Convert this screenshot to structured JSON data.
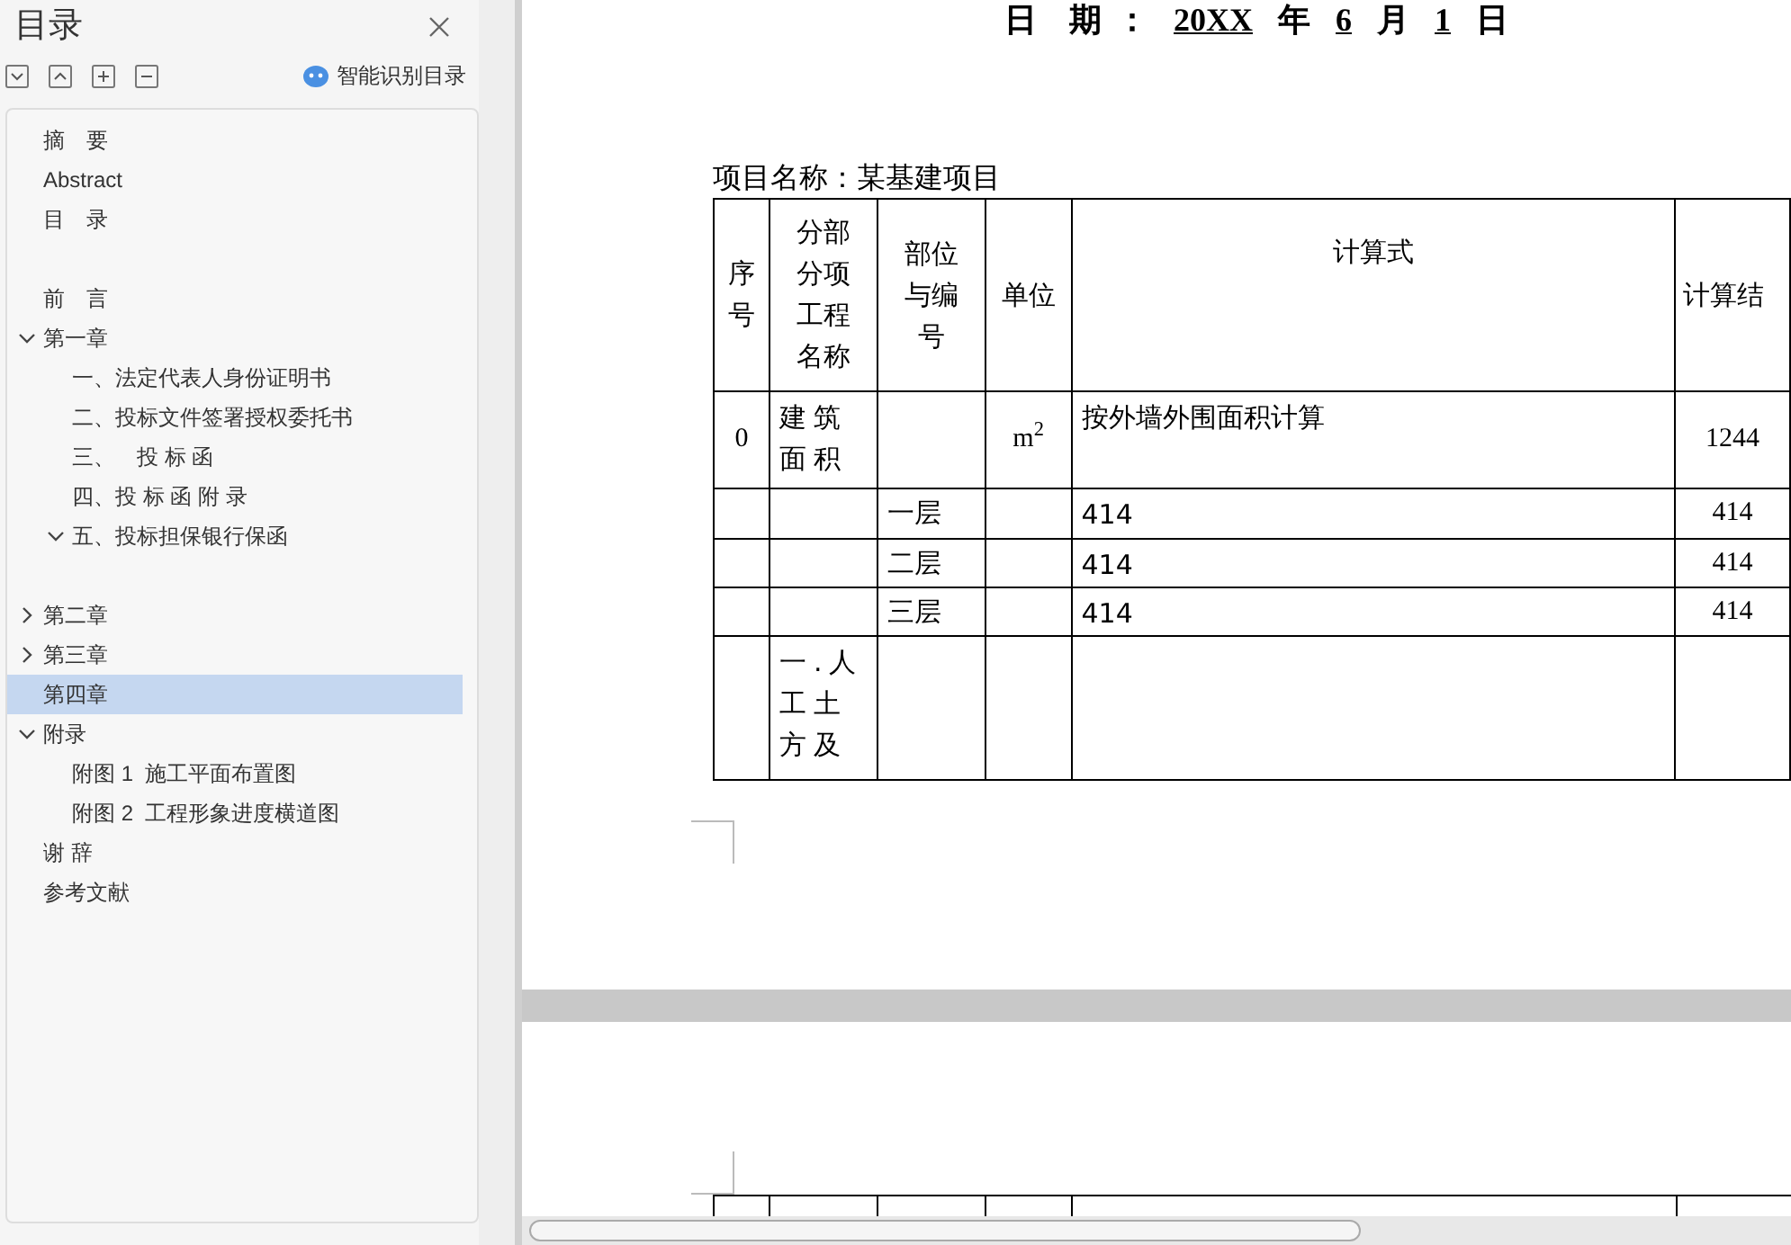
{
  "toc": {
    "title": "目录",
    "smart_button": "智能识别目录",
    "items": [
      {
        "label": "摘　要",
        "selected": false
      },
      {
        "label": "Abstract",
        "selected": false
      },
      {
        "label": "目　录",
        "selected": false
      },
      {
        "label": "前　言",
        "selected": false,
        "spaced": true
      },
      {
        "label": "第一章",
        "selected": false,
        "expanded": true,
        "children": [
          {
            "label": "一、法定代表人身份证明书",
            "selected": false
          },
          {
            "label": "二、投标文件签署授权委托书",
            "selected": false
          },
          {
            "label": "三、　投 标 函",
            "selected": false
          },
          {
            "label": "四、投 标 函 附 录",
            "selected": false
          },
          {
            "label": "五、投标担保银行保函",
            "selected": false,
            "expanded": true
          }
        ]
      },
      {
        "label": "第二章",
        "selected": false,
        "expanded": false,
        "spaced": true
      },
      {
        "label": "第三章",
        "selected": false,
        "expanded": false
      },
      {
        "label": "第四章",
        "selected": true
      },
      {
        "label": "附录",
        "selected": false,
        "expanded": true,
        "children": [
          {
            "label": "附图 1  施工平面布置图",
            "selected": false
          },
          {
            "label": "附图 2  工程形象进度横道图",
            "selected": false
          }
        ]
      },
      {
        "label": "谢 辞",
        "selected": false
      },
      {
        "label": "参考文献",
        "selected": false
      }
    ]
  },
  "document": {
    "date_line": [
      {
        "text": "日　期",
        "underlined": false
      },
      {
        "text": "：",
        "underlined": false
      },
      {
        "text": "20XX",
        "underlined": true
      },
      {
        "text": "年",
        "underlined": false
      },
      {
        "text": "6",
        "underlined": true
      },
      {
        "text": "月",
        "underlined": false
      },
      {
        "text": "1",
        "underlined": true
      },
      {
        "text": "日",
        "underlined": false
      }
    ],
    "project_label": "项目名称：某基建项目",
    "table": {
      "columns": [
        "序号",
        "分部分项工程名称",
        "部位与编号",
        "单位",
        "计算式",
        "计算结"
      ],
      "rows": [
        [
          "0",
          "建筑面积",
          "",
          "m$^{2}$",
          "按外墙外围面积计算",
          "1244"
        ],
        [
          "",
          "",
          "一层",
          "",
          "414",
          "414"
        ],
        [
          "",
          "",
          "二层",
          "",
          "414",
          "414"
        ],
        [
          "",
          "",
          "三层",
          "",
          "414",
          "414"
        ],
        [
          "",
          "一.人工土方及",
          "",
          "",
          "",
          ""
        ]
      ]
    }
  }
}
